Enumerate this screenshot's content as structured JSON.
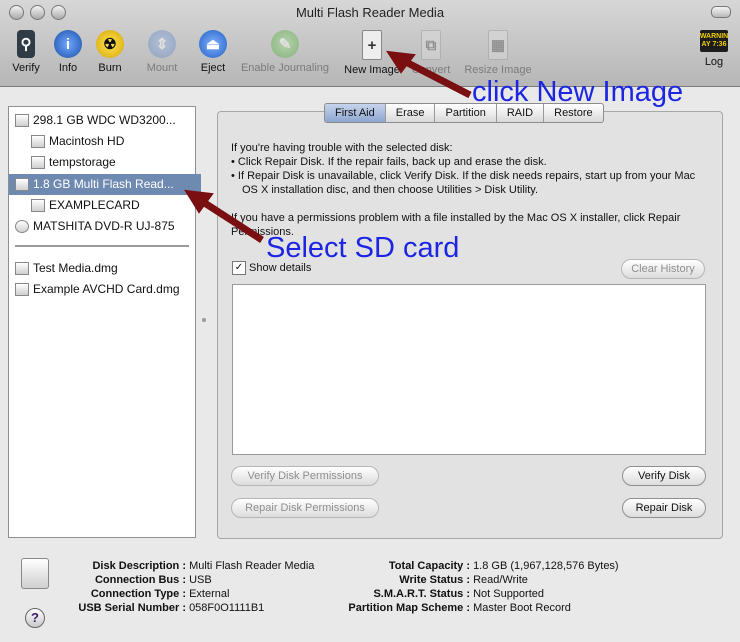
{
  "window": {
    "title": "Multi Flash Reader Media"
  },
  "toolbar": {
    "items": [
      {
        "label": "Verify",
        "icon": "microscope-icon",
        "enabled": true
      },
      {
        "label": "Info",
        "icon": "info-icon",
        "enabled": true
      },
      {
        "label": "Burn",
        "icon": "burn-icon",
        "enabled": true
      },
      {
        "label": "Mount",
        "icon": "mount-icon",
        "enabled": false
      },
      {
        "label": "Eject",
        "icon": "eject-icon",
        "enabled": true
      },
      {
        "label": "Enable Journaling",
        "icon": "journaling-icon",
        "enabled": false
      },
      {
        "label": "New Image",
        "icon": "new-image-icon",
        "enabled": true
      },
      {
        "label": "Convert",
        "icon": "convert-icon",
        "enabled": false
      },
      {
        "label": "Resize Image",
        "icon": "resize-image-icon",
        "enabled": false
      },
      {
        "label": "Log",
        "icon": "log-icon",
        "enabled": true
      }
    ],
    "log_badge": "WARNIN\nAY 7:36"
  },
  "sidebar": {
    "disks": [
      {
        "label": "298.1 GB WDC WD3200...",
        "indent": 0
      },
      {
        "label": "Macintosh HD",
        "indent": 1
      },
      {
        "label": "tempstorage",
        "indent": 1
      },
      {
        "label": "1.8 GB Multi Flash Read...",
        "indent": 0,
        "selected": true
      },
      {
        "label": "EXAMPLECARD",
        "indent": 1
      },
      {
        "label": "MATSHITA DVD-R UJ-875",
        "indent": 0
      }
    ],
    "images": [
      {
        "label": "Test Media.dmg"
      },
      {
        "label": "Example AVCHD Card.dmg"
      }
    ]
  },
  "tabs": [
    "First Aid",
    "Erase",
    "Partition",
    "RAID",
    "Restore"
  ],
  "firstaid": {
    "intro": "If you're having trouble with the selected disk:",
    "bullet1": "• Click Repair Disk. If the repair fails, back up and erase the disk.",
    "bullet2": "• If Repair Disk is unavailable, click Verify Disk. If the disk needs repairs, start up from your Mac OS X installation disc, and then choose Utilities > Disk Utility.",
    "permissions": "If you have a permissions problem with a file installed by the Mac OS X installer, click Repair Permissions.",
    "show_details": "Show details",
    "clear_history": "Clear History",
    "verify_permissions": "Verify Disk Permissions",
    "repair_permissions": "Repair Disk Permissions",
    "verify_disk": "Verify Disk",
    "repair_disk": "Repair Disk"
  },
  "info": {
    "left": [
      {
        "k": "Disk Description :",
        "v": "Multi Flash Reader Media"
      },
      {
        "k": "Connection Bus :",
        "v": "USB"
      },
      {
        "k": "Connection Type :",
        "v": "External"
      },
      {
        "k": "USB Serial Number :",
        "v": "058F0O1111B1"
      }
    ],
    "right": [
      {
        "k": "Total Capacity :",
        "v": "1.8 GB (1,967,128,576 Bytes)"
      },
      {
        "k": "Write Status :",
        "v": "Read/Write"
      },
      {
        "k": "S.M.A.R.T. Status :",
        "v": "Not Supported"
      },
      {
        "k": "Partition Map Scheme :",
        "v": "Master Boot Record"
      }
    ]
  },
  "help_label": "?",
  "annotations": {
    "new_image": "click New Image",
    "sd_card": "Select SD card"
  },
  "colors": {
    "annotation_text": "#1c26e2",
    "arrow": "#7a0f12",
    "selection": "#6f8ab1"
  }
}
